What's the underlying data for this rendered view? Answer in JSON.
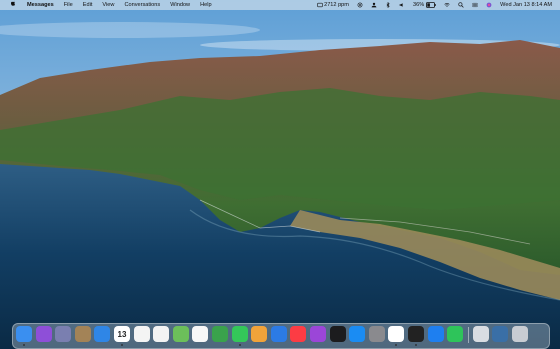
{
  "menubar": {
    "app_name": "Messages",
    "menus": [
      "File",
      "Edit",
      "View",
      "Conversations",
      "Window",
      "Help"
    ],
    "network_speed": "2712 ppm",
    "battery_percent": "36%",
    "datetime": "Wed Jan 13  8:14 AM"
  },
  "dock": {
    "apps": [
      {
        "name": "finder-icon",
        "color": "#3a8ff0"
      },
      {
        "name": "siri-icon",
        "color": "#8e4fd8"
      },
      {
        "name": "launchpad-icon",
        "color": "#7a7fb0"
      },
      {
        "name": "folder-icon",
        "color": "#a38357"
      },
      {
        "name": "safari-icon",
        "color": "#2f86e6"
      },
      {
        "name": "calendar-icon",
        "color": "#ffffff",
        "label": "13"
      },
      {
        "name": "reminders-icon",
        "color": "#f4f4f4"
      },
      {
        "name": "notes-icon",
        "color": "#f3f3f3"
      },
      {
        "name": "maps-icon",
        "color": "#6cbf5a"
      },
      {
        "name": "photos-icon",
        "color": "#f7f7f7"
      },
      {
        "name": "numbers-icon",
        "color": "#3aa24c"
      },
      {
        "name": "messages-icon",
        "color": "#34c759"
      },
      {
        "name": "pages-icon",
        "color": "#f1a33a"
      },
      {
        "name": "keynote-icon",
        "color": "#2c7be5"
      },
      {
        "name": "music-icon",
        "color": "#fc3c44"
      },
      {
        "name": "podcasts-icon",
        "color": "#9b46d8"
      },
      {
        "name": "apple-tv-icon",
        "color": "#1c1c1e"
      },
      {
        "name": "app-store-icon",
        "color": "#1a8cf3"
      },
      {
        "name": "system-preferences-icon",
        "color": "#8a8a8e"
      },
      {
        "name": "chrome-icon",
        "color": "#ffffff"
      },
      {
        "name": "terminal-icon",
        "color": "#222222"
      },
      {
        "name": "mail-icon",
        "color": "#1e7ff0"
      },
      {
        "name": "facetime-icon",
        "color": "#2ec45a"
      }
    ],
    "right_items": [
      {
        "name": "downloads-stack-icon",
        "color": "#d9dde2"
      },
      {
        "name": "screenshot-stack-icon",
        "color": "#3a6fa6"
      },
      {
        "name": "trash-icon",
        "color": "#c8ccd2"
      }
    ]
  }
}
